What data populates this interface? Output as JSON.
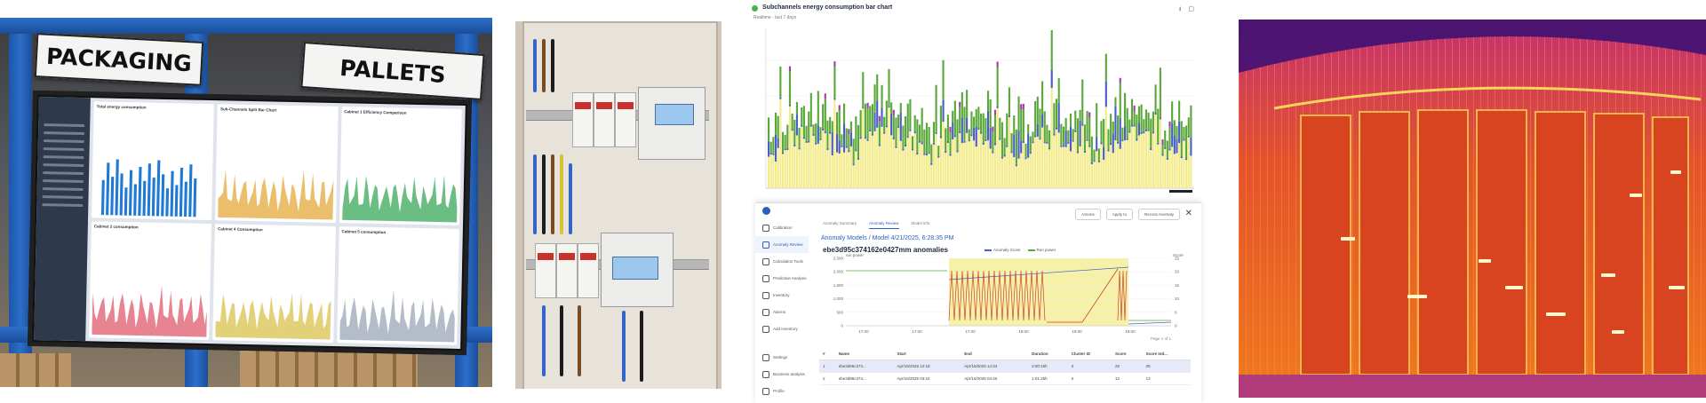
{
  "photo_warehouse": {
    "sign_left": "PACKAGING",
    "sign_right": "PALLETS",
    "screen_panels": [
      {
        "title": "Total energy consumption",
        "color": "#1f7ad6"
      },
      {
        "title": "Sub-Channels Split Bar Chart",
        "color": "#e3a83a"
      },
      {
        "title": "Cabinet 1 Efficiency Comparison",
        "color": "#39a85a"
      },
      {
        "title": "Cabinet 2 consumption",
        "color": "#e05a6e"
      },
      {
        "title": "Cabinet 4 Consumption",
        "color": "#d9c24e"
      },
      {
        "title": "Cabinet 5 consumption",
        "color": "#9aa6b5"
      }
    ]
  },
  "photo_cabinet": {},
  "dashboard": {
    "title": "Subchannels energy consumption bar chart",
    "subtitle": "Realtime - last 7 days",
    "colors": {
      "yellow": "#f4ec8c",
      "green": "#5aa83a",
      "blue": "#4a5fc0",
      "purple": "#a23ca8",
      "accent": "#2b5fbf"
    },
    "chart_data": {
      "type": "bar",
      "stacked": true,
      "series_count": 4
    },
    "anomaly": {
      "close_label": "✕",
      "tabs": [
        "Anomaly Summary",
        "Anomaly Review",
        "Model info"
      ],
      "active_tab": 1,
      "buttons": [
        "Actions",
        "Apply to",
        "Record Anomaly"
      ],
      "sidebar": [
        "Calibration",
        "Anomaly Review",
        "Calculation Tools",
        "Predictive Analysis",
        "Inventory",
        "Alarms",
        "Add Inventory"
      ],
      "sidebar_bottom": [
        "Settings",
        "Business analysis",
        "Profile"
      ],
      "breadcrumb": "Anomaly Models / Model 4/21/2025, 6:28:35 PM",
      "heading": "ebe3d95c374162e0427mm anomalies",
      "legend": [
        "Anomaly Score",
        "Run power"
      ],
      "ylabel_left": "run power",
      "ylabel_right": "Score",
      "x_ticks": [
        "17:00",
        "17:00",
        "17:00",
        "18:00",
        "18:00",
        "19:00"
      ],
      "y_ticks_left": [
        "2,500",
        "2,000",
        "1,500",
        "1,000",
        "500",
        "0"
      ],
      "y_ticks_right": [
        "25",
        "20",
        "15",
        "10",
        "5",
        "0"
      ],
      "page_label": "Page 1 of 1",
      "table": {
        "headers": [
          "#",
          "Name",
          "Start",
          "End",
          "Duration",
          "Cluster ID",
          "Score",
          "Score Ind..."
        ],
        "rows": [
          [
            "1",
            "ebe3d95c374...",
            "Apr/15/2025 12:18",
            "Apr/15/2025 14:34",
            "2:00:15h",
            "0",
            "25",
            "25"
          ],
          [
            "2",
            "ebe3d95c374...",
            "Apr/16/2025 03:22",
            "Apr/16/2025 04:40",
            "1:01:25h",
            "0",
            "12",
            "13"
          ]
        ]
      }
    }
  },
  "photo_thermal": {}
}
